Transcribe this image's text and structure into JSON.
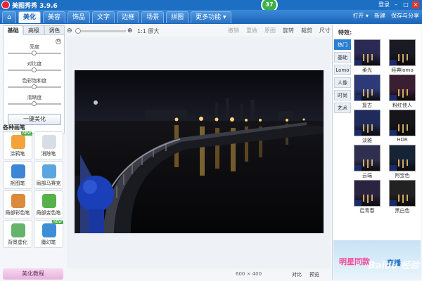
{
  "app": {
    "title": "美图秀秀 3.9.6",
    "account": "登录"
  },
  "badge": "37",
  "nav": {
    "tabs": [
      "美化",
      "美容",
      "饰品",
      "文字",
      "边框",
      "场景",
      "拼图",
      "更多功能 ▾"
    ],
    "right": {
      "open": "打开 ▾",
      "new": "新建",
      "save": "保存与分享"
    }
  },
  "toolbar": {
    "zoom_actual": "1:1 原大",
    "undo": "撤销",
    "redo": "重做",
    "reset": "原图",
    "rotate": "旋转",
    "crop": "裁剪",
    "size": "尺寸"
  },
  "left": {
    "subtabs": [
      "基础",
      "高级",
      "调色"
    ],
    "adjust": [
      {
        "label": "亮度",
        "value": 0.5
      },
      {
        "label": "对比度",
        "value": 0.5
      },
      {
        "label": "色彩饱和度",
        "value": 0.5
      },
      {
        "label": "清晰度",
        "value": 0.5
      }
    ],
    "one_key": "一键美化",
    "brush_title": "各种画笔",
    "brushes": [
      {
        "label": "涂鸦笔",
        "color": "#f2a33a",
        "is_new": true
      },
      {
        "label": "消除笔",
        "color": "#d7dde4",
        "is_new": false
      },
      {
        "label": "抠图笔",
        "color": "#3d86d6",
        "is_new": false
      },
      {
        "label": "局部马赛克",
        "color": "#59a6e0",
        "is_new": false
      },
      {
        "label": "局部彩色笔",
        "color": "#d98a3a",
        "is_new": false
      },
      {
        "label": "局部变色笔",
        "color": "#56b14a",
        "is_new": false
      },
      {
        "label": "背景虚化",
        "color": "#66b36b",
        "is_new": false
      },
      {
        "label": "魔幻笔",
        "color": "#3d8ed6",
        "is_new": true
      }
    ],
    "new_tag": "NEW",
    "tutorial": "美化教程"
  },
  "status": {
    "dims": "600 × 400",
    "compare": "对比",
    "preview": "预览"
  },
  "effects": {
    "title": "特效:",
    "categories": [
      "热门",
      "基础",
      "Lomo",
      "人像",
      "时尚",
      "艺术"
    ],
    "active_category": "热门",
    "items": [
      {
        "label": "柔光",
        "tone": "#2a2a55"
      },
      {
        "label": "经典lomo",
        "tone": "#1a1a22"
      },
      {
        "label": "复古",
        "tone": "#2d3a7a"
      },
      {
        "label": "粉红佳人",
        "tone": "#3a1f33"
      },
      {
        "label": "淡雅",
        "tone": "#1f2b5a"
      },
      {
        "label": "HDR",
        "tone": "#15151a"
      },
      {
        "label": "云端",
        "tone": "#2f3050"
      },
      {
        "label": "阿宝色",
        "tone": "#162436"
      },
      {
        "label": "后青春",
        "tone": "#2a2440"
      },
      {
        "label": "黑白色",
        "tone": "#222222"
      }
    ],
    "ad": {
      "line1": "明星同款",
      "line2": "直播"
    }
  },
  "watermark": "Baidu 经验"
}
